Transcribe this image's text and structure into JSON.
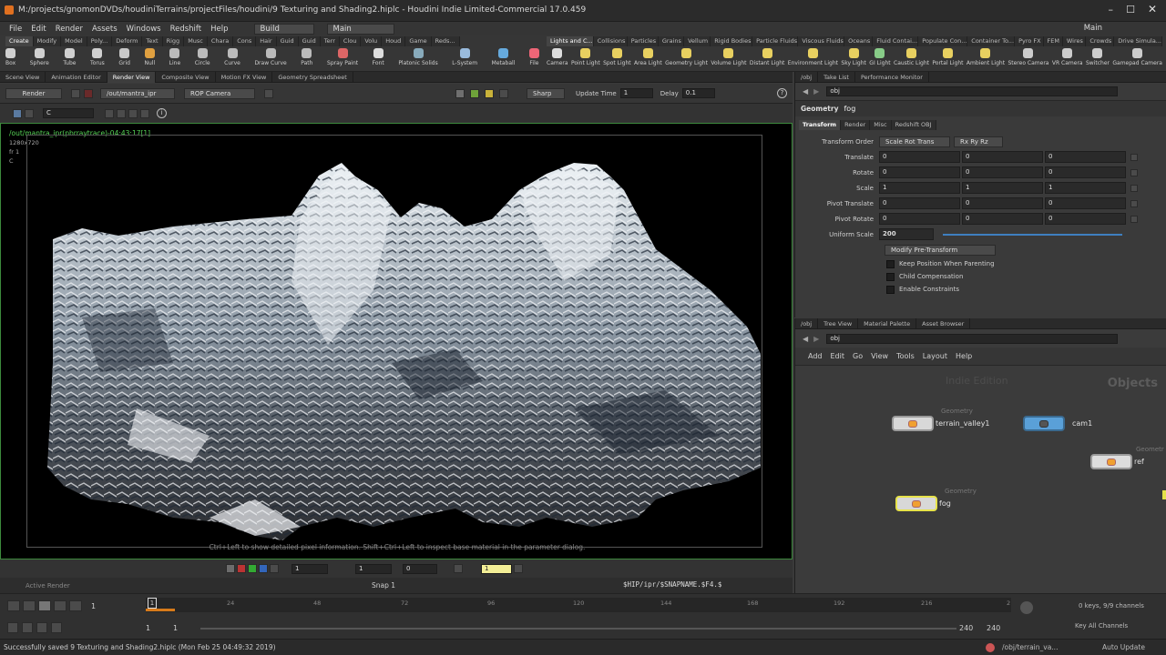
{
  "window": {
    "title": "M:/projects/gnomonDVDs/houdiniTerrains/projectFiles/houdini/9 Texturing and Shading2.hiplc - Houdini Indie Limited-Commercial 17.0.459"
  },
  "menu": [
    "File",
    "Edit",
    "Render",
    "Assets",
    "Windows",
    "Redshift",
    "Help"
  ],
  "desktop": {
    "build_label": "Build",
    "main_label": "Main",
    "right_main": "Main"
  },
  "shelf_left": {
    "tabs": [
      "Create",
      "Modify",
      "Model",
      "Poly...",
      "Deform",
      "Text",
      "Rigg",
      "Musc",
      "Chara",
      "Cons",
      "Hair",
      "Guid",
      "Guid",
      "Terr",
      "Clou",
      "Volu",
      "Houd",
      "Game",
      "Reds..."
    ],
    "tools": [
      "Box",
      "Sphere",
      "Tube",
      "Torus",
      "Grid",
      "Null",
      "Line",
      "Circle",
      "Curve",
      "Draw Curve",
      "Path",
      "Spray Paint",
      "Font",
      "Platonic Solids",
      "L-System",
      "Metaball",
      "File"
    ]
  },
  "shelf_right": {
    "tabs": [
      "Lights and C...",
      "Collisions",
      "Particles",
      "Grains",
      "Vellum",
      "Rigid Bodies",
      "Particle Fluids",
      "Viscous Fluids",
      "Oceans",
      "Fluid Contai...",
      "Populate Con...",
      "Container To...",
      "Pyro FX",
      "FEM",
      "Wires",
      "Crowds",
      "Drive Simula..."
    ],
    "tools": [
      "Camera",
      "Point Light",
      "Spot Light",
      "Area Light",
      "Geometry Light",
      "Volume Light",
      "Distant Light",
      "Environment Light",
      "Sky Light",
      "GI Light",
      "Caustic Light",
      "Portal Light",
      "Ambient Light",
      "Stereo Camera",
      "VR Camera",
      "Switcher",
      "Gamepad Camera"
    ]
  },
  "left_pane_tabs": [
    "Scene View",
    "Animation Editor",
    "Render View",
    "Composite View",
    "Motion FX View",
    "Geometry Spreadsheet"
  ],
  "render_toolbar": {
    "render_button": "Render",
    "output_path": "/out/mantra_ipr",
    "camera": "ROP Camera",
    "quality": "Sharp",
    "update_label": "Update Time",
    "update_value": "1",
    "delay_label": "Delay",
    "delay_value": "0.1"
  },
  "view_toolbar": {
    "channel": "C"
  },
  "render_view": {
    "render_info": "/out/mantra_ipr(pbrraytrace)-04:43:17[1]",
    "resolution": "1280x720",
    "frame": "fr 1",
    "channel_c": "C",
    "hint": "Ctrl+Left to show detailed pixel information. Shift+Ctrl+Left to inspect base material in the parameter dialog."
  },
  "view_bottom": {
    "field1": "1",
    "field2": "1",
    "field3": "0",
    "field4": "1"
  },
  "status_row": {
    "active_render": "Active Render",
    "snap": "Snap 1",
    "path_expr": "$HIP/ipr/$SNAPNAME.$F4.$"
  },
  "timeline": {
    "frame": "1",
    "ticks": [
      "24",
      "48",
      "72",
      "96",
      "120",
      "144",
      "168",
      "192",
      "216",
      "2"
    ],
    "start": "1",
    "start2": "1",
    "end": "240",
    "end2": "240",
    "keys": "0 keys, 9/9 channels",
    "key_all": "Key All Channels"
  },
  "status_bar": {
    "message": "Successfully saved 9 Texturing and Shading2.hiplc (Mon Feb 25 04:49:32 2019)",
    "obj_path": "/obj/terrain_va...",
    "auto_update": "Auto Update"
  },
  "param_pane": {
    "tabs": [
      "/obj",
      "Take List",
      "Performance Monitor"
    ],
    "path": "obj",
    "node_type": "Geometry",
    "node_name": "fog",
    "sub_tabs": [
      "Transform",
      "Render",
      "Misc",
      "Redshift OBJ"
    ],
    "transform_order_label": "Transform Order",
    "transform_order": "Scale Rot Trans",
    "rot_order": "Rx Ry Rz",
    "rows": [
      {
        "label": "Translate",
        "values": [
          "0",
          "0",
          "0"
        ]
      },
      {
        "label": "Rotate",
        "values": [
          "0",
          "0",
          "0"
        ]
      },
      {
        "label": "Scale",
        "values": [
          "1",
          "1",
          "1"
        ]
      },
      {
        "label": "Pivot Translate",
        "values": [
          "0",
          "0",
          "0"
        ]
      },
      {
        "label": "Pivot Rotate",
        "values": [
          "0",
          "0",
          "0"
        ]
      }
    ],
    "uniform_scale_label": "Uniform Scale",
    "uniform_scale": "200",
    "modify_button": "Modify Pre-Transform",
    "checks": [
      "Keep Position When Parenting",
      "Child Compensation",
      "Enable Constraints"
    ]
  },
  "network_pane": {
    "tabs": [
      "/obj",
      "Tree View",
      "Material Palette",
      "Asset Browser"
    ],
    "path": "obj",
    "menu": [
      "Add",
      "Edit",
      "Go",
      "View",
      "Tools",
      "Layout",
      "Help"
    ],
    "watermark": "Indie Edition",
    "context": "Objects",
    "nodes": [
      {
        "category": "Geometry",
        "name": "terrain_valley1"
      },
      {
        "category": "",
        "name": "cam1"
      },
      {
        "category": "Geometr",
        "name": "ref"
      },
      {
        "category": "Geometry",
        "name": "fog"
      }
    ]
  },
  "colors": {
    "accent_green": "#4fc34f",
    "selected_yellow": "#e6e24a",
    "bg": "#3a3a3a"
  }
}
